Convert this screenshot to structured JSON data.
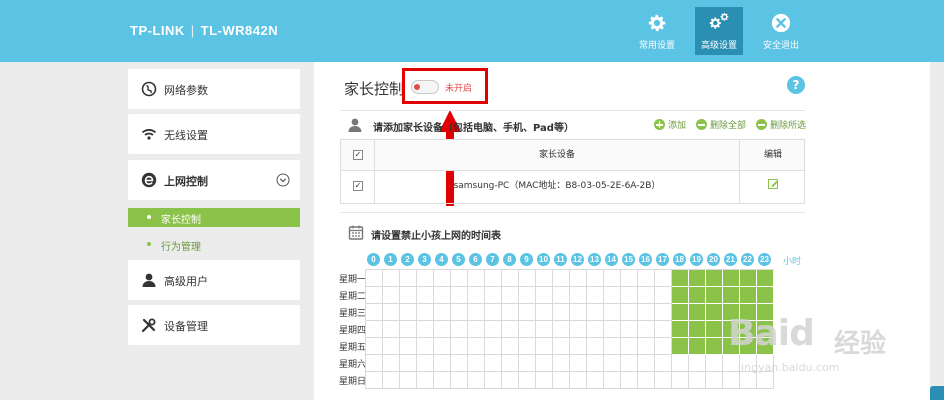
{
  "header": {
    "brand": "TP-LINK",
    "separator": "|",
    "model": "TL-WR842N",
    "nav": [
      {
        "label": "常用设置",
        "icon": "gear-icon"
      },
      {
        "label": "高级设置",
        "icon": "gears-icon",
        "active": true
      },
      {
        "label": "安全退出",
        "icon": "close-circle-icon"
      }
    ]
  },
  "sidebar": {
    "items": [
      {
        "label": "网络参数",
        "icon": "globe-icon"
      },
      {
        "label": "无线设置",
        "icon": "wifi-icon"
      },
      {
        "label": "上网控制",
        "icon": "internet-e-icon",
        "expanded": true
      },
      {
        "label": "高级用户",
        "icon": "user-icon"
      },
      {
        "label": "设备管理",
        "icon": "tools-icon"
      }
    ],
    "subitems": [
      {
        "label": "家长控制",
        "active": true
      },
      {
        "label": "行为管理",
        "active": false
      }
    ]
  },
  "main": {
    "title": "家长控制",
    "toggle_status": "未开启",
    "help": "?",
    "device_section": {
      "heading": "请添加家长设备（包括电脑、手机、Pad等）",
      "actions": [
        "添加",
        "删除全部",
        "删除所选"
      ],
      "columns": [
        "家长设备",
        "编辑"
      ],
      "header_checked": "✓",
      "rows": [
        {
          "device": "samsung-PC（MAC地址：B8-03-05-2E-6A-2B）",
          "checked": "✓"
        }
      ]
    },
    "schedule_section": {
      "heading": "请设置禁止小孩上网的时间表",
      "hours": [
        "0",
        "1",
        "2",
        "3",
        "4",
        "5",
        "6",
        "7",
        "8",
        "9",
        "10",
        "11",
        "12",
        "13",
        "14",
        "15",
        "16",
        "17",
        "18",
        "19",
        "20",
        "21",
        "22",
        "23"
      ],
      "hour_unit": "小时",
      "days": [
        "星期一",
        "星期二",
        "星期三",
        "星期四",
        "星期五",
        "星期六",
        "星期日"
      ],
      "blocked_hours": [
        18,
        19,
        20,
        21,
        22,
        23
      ],
      "blocked_days": [
        0,
        1,
        2,
        3,
        4
      ]
    }
  },
  "watermark": {
    "logo": "Baid",
    "logo_suffix": "经验",
    "url": "jingyan.baidu.com"
  },
  "colors": {
    "header": "#5bc3e4",
    "accent_green": "#8bc34a",
    "alert_red": "#e00000",
    "active_nav": "#2b8fb3"
  }
}
